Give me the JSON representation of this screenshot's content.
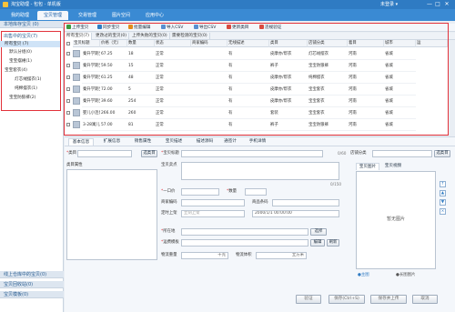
{
  "window": {
    "title": "淘宝助理 - 包包 · 单机版",
    "user_label": "未登录 ▾",
    "controls": [
      "—",
      "□",
      "✕"
    ]
  },
  "nav": {
    "tabs": [
      "我的助理",
      "宝贝管理",
      "交易管理",
      "图片空间",
      "应用中心"
    ],
    "active": 1
  },
  "left_panel": {
    "local_header": "本地库存宝贝 (0)",
    "selected_header": "出售中的宝贝(7)",
    "tree": [
      {
        "label": "所有宝贝 (7)",
        "indent": 0,
        "selected": true
      },
      {
        "label": "默认分组(0)",
        "indent": 1
      },
      {
        "label": "宝宝摆裙(1)",
        "indent": 1
      },
      {
        "label": "宝宝套衣(4)",
        "indent": 0
      },
      {
        "label": "灯芯绒摆衣(1)",
        "indent": 2
      },
      {
        "label": "纯棉摆衣(1)",
        "indent": 2
      },
      {
        "label": "宝宝防狼裤(2)",
        "indent": 1
      }
    ],
    "bottom_headers": [
      "线上仓库中的宝贝(0)",
      "宝贝回收站(0)",
      "宝贝模板(0)"
    ]
  },
  "toolbar": {
    "buttons": [
      {
        "label": "上传宝贝",
        "color": "#3c9a3c"
      },
      {
        "label": "同步宝贝",
        "color": "#2f7bc3"
      },
      {
        "label": "批量编辑",
        "color": "#e38b1b"
      },
      {
        "label": "导入CSV",
        "color": "#5a8fd0"
      },
      {
        "label": "导出CSV",
        "color": "#5a8fd0"
      },
      {
        "label": "更新类目",
        "color": "#d84a3f"
      },
      {
        "label": "违规验证",
        "color": "#d84a3f"
      }
    ]
  },
  "subtabs": [
    "所有宝贝(7)",
    "更改过的宝贝(0)",
    "上传失败的宝贝(0)",
    "需要检测的宝贝(0)"
  ],
  "table": {
    "headers": [
      "宝贝标题",
      "价格（元）",
      "数量",
      "状态",
      "商家编码",
      "无线描述",
      "类目",
      "店铺分类",
      "着目",
      "城市",
      "运"
    ],
    "rows": [
      [
        "秦升学期宝宝...",
        "67.25",
        "18",
        "正常",
        "",
        "有",
        "皮摩亦/帮衣",
        "灯芯绒摆衣",
        "河南",
        "省城"
      ],
      [
        "秦升学期宝宝...",
        "59.50",
        "15",
        "正常",
        "",
        "有",
        "裤子",
        "宝宝防狼裤",
        "河南",
        "省城"
      ],
      [
        "秦升学期宝...",
        "61.25",
        "48",
        "正常",
        "",
        "有",
        "皮摩亦/帮衣",
        "纯棉摆衣",
        "河南",
        "省城"
      ],
      [
        "秦升学期宝...",
        "72.00",
        "5",
        "正常",
        "",
        "有",
        "皮摩亦/帮衣",
        "宝宝套衣",
        "河南",
        "省城"
      ],
      [
        "秦升学期宝...",
        "39.60",
        "254",
        "正常",
        "",
        "有",
        "皮摩亦/帮衣",
        "宝宝套衣",
        "河南",
        "省城"
      ],
      [
        "婴儿小连体...",
        "266.00",
        "260",
        "正常",
        "",
        "有",
        "套装",
        "宝宝套衣",
        "河南",
        "省城"
      ],
      [
        "3-28寓儿...",
        "57.00",
        "81",
        "正常",
        "",
        "有",
        "裤子",
        "宝宝防狼裤",
        "河南",
        "省城"
      ]
    ]
  },
  "editor": {
    "tabs": [
      "基本信息",
      "扩展信息",
      "销售属性",
      "宝贝描述",
      "描述源码",
      "通签计",
      "手机详情"
    ],
    "labels": {
      "category": "类目",
      "select_category": "选类目",
      "item_attr": "类目属性",
      "title": "宝贝标题",
      "title_count": "0/60",
      "selling_point": "宝贝卖点",
      "selling_count": "0/150",
      "price": "一口价",
      "quantity": "数量",
      "merchant_code": "商家编码",
      "barcode": "商品条码",
      "schedule": "定时上架",
      "schedule_placeholder": "立刻上架",
      "schedule_date": "2000/1/1 00:00:00",
      "location": "所在地",
      "location_select": "选择",
      "freight": "运费模板",
      "edit": "编辑",
      "refresh": "刷新",
      "weight": "物流重量",
      "volume": "物流体积",
      "unit_kg": "千克",
      "unit_m3": "立方米",
      "shop_cat": "店铺分类",
      "shop_cat_btn": "选类目",
      "image_tab": "宝贝图片",
      "video_tab": "宝贝视频",
      "no_image": "暂无图片",
      "main_color": "●主图",
      "long_image": "●长图图片"
    },
    "footer_buttons": [
      "验证",
      "保存(Ctrl+S)",
      "保存并上传",
      "取消"
    ]
  }
}
